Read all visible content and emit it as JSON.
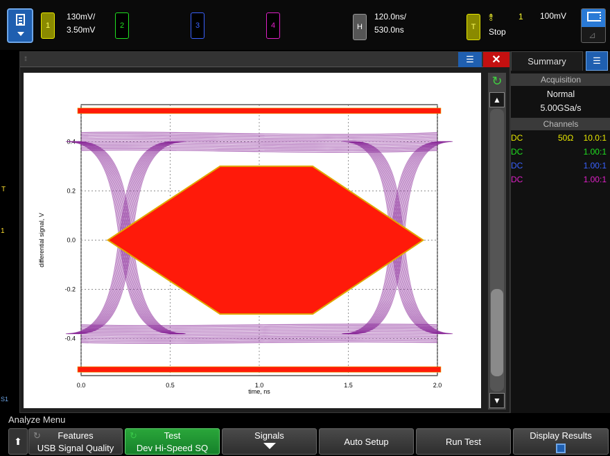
{
  "top": {
    "ch1": {
      "label": "1",
      "scale": "130mV/",
      "offset": "3.50mV",
      "color": "#e8e800"
    },
    "ch2": {
      "label": "2",
      "color": "#20e020"
    },
    "ch3": {
      "label": "3",
      "color": "#3a62ff"
    },
    "ch4": {
      "label": "4",
      "color": "#e020c8"
    },
    "horizontal": {
      "label": "H",
      "scale": "120.0ns/",
      "delay": "530.0ns"
    },
    "trigger": {
      "label": "T",
      "source": "1",
      "level": "100mV",
      "state": "Stop"
    }
  },
  "left_markers": {
    "trigger": "T",
    "ch1": "1",
    "serial": "S1"
  },
  "summary": {
    "tab": "Summary",
    "acq_header": "Acquisition",
    "acq_mode": "Normal",
    "acq_rate": "5.00GSa/s",
    "channels_header": "Channels",
    "channels": [
      {
        "coupling": "DC",
        "impedance": "50Ω",
        "ratio": "10.0:1",
        "color": "#e8e800"
      },
      {
        "coupling": "DC",
        "impedance": "",
        "ratio": "1.00:1",
        "color": "#20e020"
      },
      {
        "coupling": "DC",
        "impedance": "",
        "ratio": "1.00:1",
        "color": "#3a62ff"
      },
      {
        "coupling": "DC",
        "impedance": "",
        "ratio": "1.00:1",
        "color": "#e020c8"
      }
    ]
  },
  "bottom": {
    "menu_title": "Analyze Menu",
    "keys": [
      {
        "l1": "Features",
        "l2": "USB Signal Quality"
      },
      {
        "l1": "Test",
        "l2": "Dev Hi-Speed SQ"
      },
      {
        "l1": "Signals"
      },
      {
        "l1": "Auto Setup"
      },
      {
        "l1": "Run Test"
      },
      {
        "l1": "Display Results"
      }
    ]
  },
  "chart_data": {
    "type": "eye-diagram",
    "xlabel": "time, ns",
    "ylabel": "differential signal, V",
    "xlim": [
      0.0,
      2.0
    ],
    "ylim": [
      -0.55,
      0.55
    ],
    "xticks": [
      "0.0",
      "0.5",
      "1.0",
      "1.5",
      "2.0"
    ],
    "yticks": [
      "0.4",
      "0.2",
      "0.0",
      "-0.2",
      "-0.4"
    ],
    "grid": true,
    "trace_color": "#8a2a9a",
    "mask_color": "#ff1a0a",
    "mask_edge_color": "#e0a800",
    "eye_mask": {
      "polygon_x": [
        0.15,
        0.78,
        1.3,
        1.92,
        1.3,
        0.78
      ],
      "polygon_y": [
        0.0,
        0.3,
        0.3,
        0.0,
        -0.3,
        -0.3
      ]
    },
    "limit_levels": [
      0.525,
      -0.525
    ],
    "eye_high": 0.4,
    "eye_low": -0.38
  }
}
